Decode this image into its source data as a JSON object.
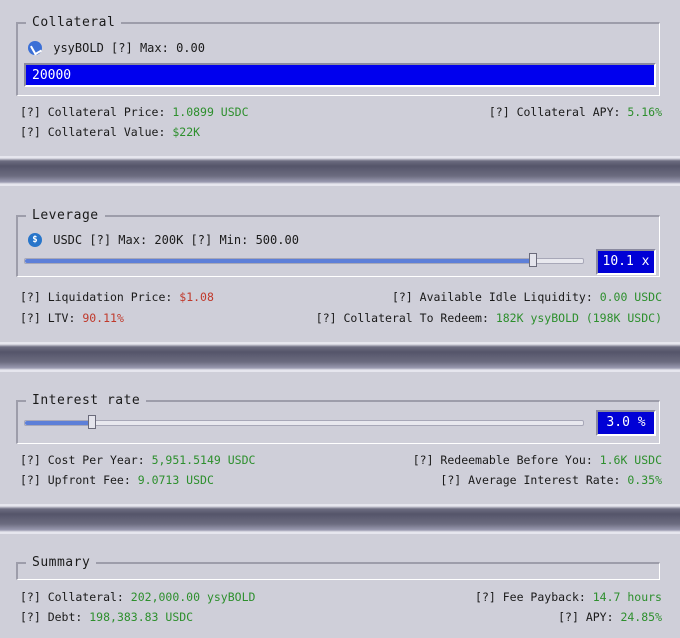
{
  "collateral": {
    "title": "Collateral",
    "token": "ysyBOLD",
    "max_prefix": "[?] Max:",
    "max_value": "0.00",
    "input_value": "20000",
    "price_label": "[?] Collateral Price:",
    "price_value": "1.0899 USDC",
    "apy_label": "[?] Collateral APY:",
    "apy_value": "5.16%",
    "value_label": "[?] Collateral Value:",
    "value_value": "$22K"
  },
  "leverage": {
    "title": "Leverage",
    "token": "USDC",
    "max_prefix": "[?] Max:",
    "max_value": "200K",
    "min_prefix": "[?] Min:",
    "min_value": "500.00",
    "display": "10.1 x",
    "slider_fraction": 0.91,
    "liq_label": "[?] Liquidation Price:",
    "liq_value": "$1.08",
    "idle_label": "[?] Available Idle Liquidity:",
    "idle_value": "0.00 USDC",
    "ltv_label": "[?] LTV:",
    "ltv_value": "90.11%",
    "redeem_label": "[?] Collateral To Redeem:",
    "redeem_value": "182K ysyBOLD (198K USDC)"
  },
  "interest": {
    "title": "Interest rate",
    "display": "3.0 %",
    "slider_fraction": 0.12,
    "cost_label": "[?] Cost Per Year:",
    "cost_value": "5,951.5149 USDC",
    "redeemable_label": "[?] Redeemable Before You:",
    "redeemable_value": "1.6K USDC",
    "fee_label": "[?] Upfront Fee:",
    "fee_value": "9.0713 USDC",
    "avg_label": "[?] Average Interest Rate:",
    "avg_value": "0.35%"
  },
  "summary": {
    "title": "Summary",
    "collateral_label": "[?] Collateral:",
    "collateral_value": "202,000.00 ysyBOLD",
    "payback_label": "[?] Fee Payback:",
    "payback_value": "14.7 hours",
    "debt_label": "[?] Debt:",
    "debt_value": "198,383.83 USDC",
    "apy_label": "[?] APY:",
    "apy_value": "24.85%"
  },
  "colors": {
    "positive": "#2d8f2d",
    "negative": "#c0392b",
    "accent_input": "#0000ee",
    "slider_fill": "#5d7fd8"
  }
}
